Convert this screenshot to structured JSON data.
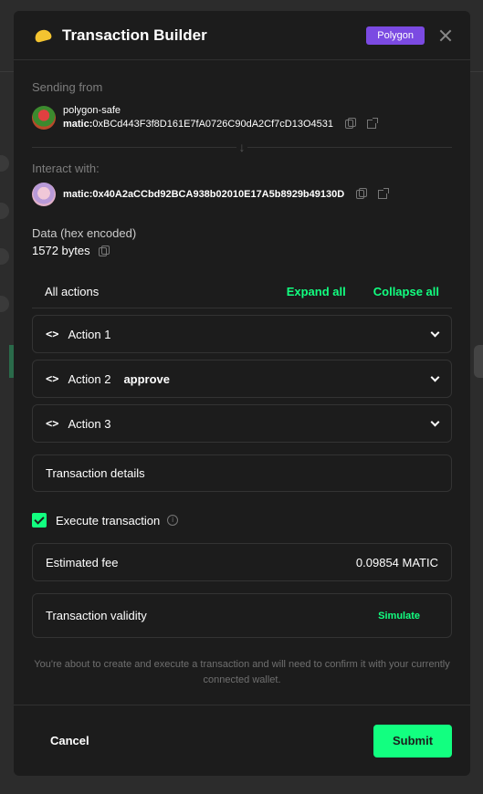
{
  "header": {
    "title": "Transaction Builder",
    "network_badge": "Polygon"
  },
  "sending_from": {
    "label": "Sending from",
    "name": "polygon-safe",
    "prefix": "matic:",
    "address": "0xBCd443F3f8D161E7fA0726C90dA2Cf7cD13O4531"
  },
  "interact_with": {
    "label": "Interact with:",
    "prefix": "matic:",
    "address": "0x40A2aCCbd92BCA938b02010E17A5b8929b49130D"
  },
  "data": {
    "label": "Data (hex encoded)",
    "size": "1572 bytes"
  },
  "actions": {
    "title": "All actions",
    "expand_all": "Expand all",
    "collapse_all": "Collapse all",
    "items": [
      {
        "code": "<>",
        "label": "Action 1",
        "method": ""
      },
      {
        "code": "<>",
        "label": "Action 2",
        "method": "approve"
      },
      {
        "code": "<>",
        "label": "Action 3",
        "method": ""
      }
    ]
  },
  "transaction_details": {
    "label": "Transaction details"
  },
  "execute": {
    "label": "Execute transaction",
    "checked": true,
    "info": "i"
  },
  "fee": {
    "label": "Estimated fee",
    "value": "0.09854 MATIC"
  },
  "validity": {
    "label": "Transaction validity",
    "action": "Simulate"
  },
  "disclaimer": "You're about to create and execute a transaction and will need to confirm it with your currently connected wallet.",
  "footer": {
    "cancel": "Cancel",
    "submit": "Submit"
  },
  "colors": {
    "accent": "#12ff80",
    "badge": "#7b4ae2",
    "modal_bg": "#1c1c1c"
  }
}
